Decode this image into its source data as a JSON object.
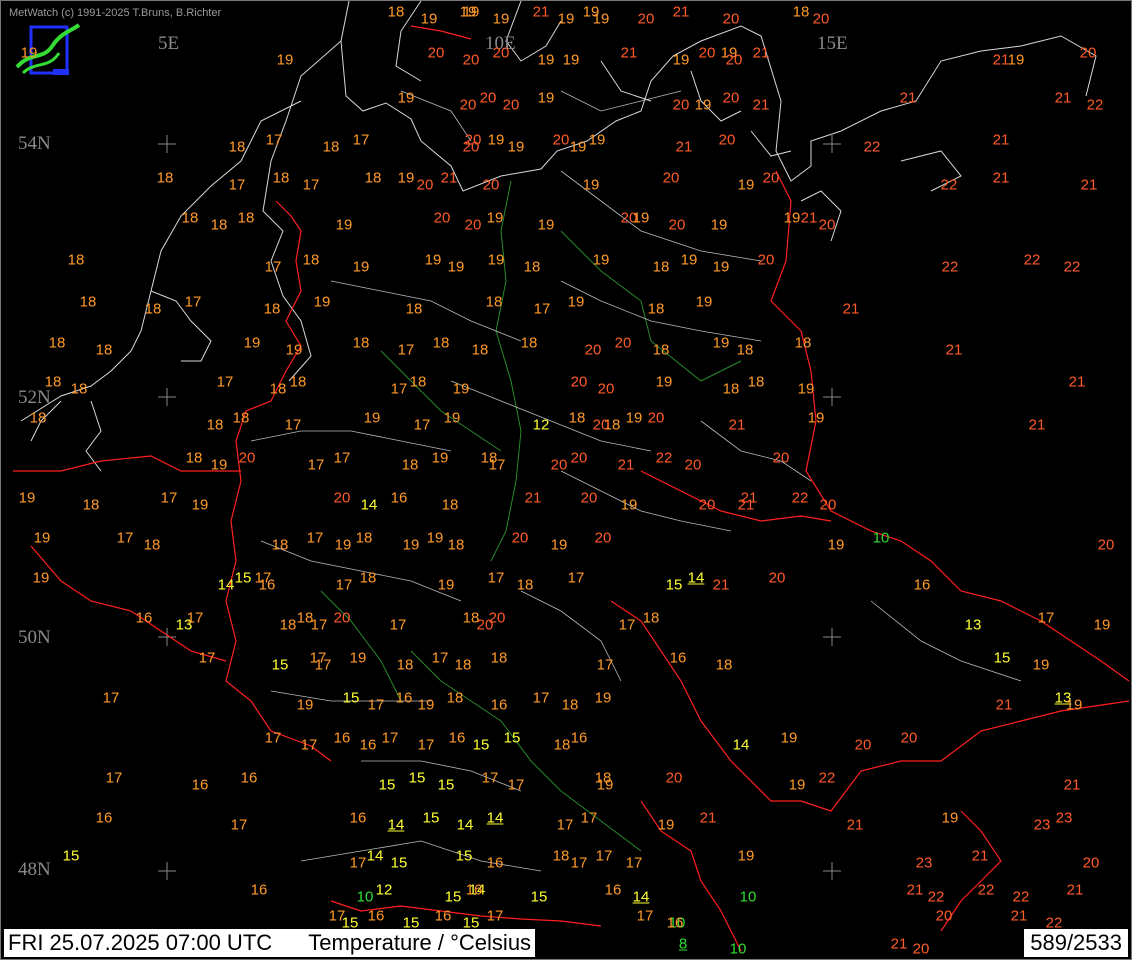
{
  "copyright": "MetWatch  (c) 1991-2025 T.Bruns, B.Richter",
  "footer": {
    "datetime": "FRI 25.07.2025 07:00 UTC",
    "parameter": "Temperature / °Celsius",
    "station_count": "589/2533"
  },
  "grid_labels": {
    "lon": [
      "5E",
      "10E",
      "15E"
    ],
    "lat": [
      "54N",
      "52N",
      "50N",
      "48N"
    ]
  },
  "colors": {
    "orange": "#ff9a2a",
    "red": "#ff5a2a",
    "yellow": "#ffff30",
    "green": "#33dd33",
    "border": "#ff2020",
    "coast": "#d8d8d8",
    "river": "#2a8a2a"
  },
  "icons": [
    "metwatch-logo-icon"
  ],
  "observations": {
    "row_020": [
      "18",
      "19",
      "19",
      "19",
      "21",
      "19",
      "19",
      "20",
      "21",
      "20",
      "18",
      "20",
      "19",
      "19"
    ],
    "row_060": [
      "19",
      "19",
      "20",
      "20",
      "20",
      "19",
      "21",
      "19",
      "20",
      "21",
      "19",
      "19",
      "20",
      "19",
      "21",
      "20"
    ],
    "row_100": [
      "19",
      "20",
      "20",
      "20",
      "19",
      "19",
      "20",
      "21",
      "21",
      "20",
      "21",
      "22"
    ],
    "row_140": [
      "17",
      "18",
      "20",
      "20",
      "19",
      "19",
      "20",
      "19",
      "19",
      "21",
      "20",
      "22",
      "21",
      "18",
      "17"
    ],
    "row_180": [
      "18",
      "17",
      "18",
      "17",
      "18",
      "20",
      "21",
      "20",
      "19",
      "19",
      "20",
      "19",
      "20",
      "22",
      "21",
      "21"
    ],
    "row_220": [
      "18",
      "18",
      "18",
      "19",
      "20",
      "20",
      "19",
      "19",
      "20",
      "20",
      "19",
      "19",
      "21",
      "20",
      "19"
    ],
    "row_260": [
      "18",
      "17",
      "18",
      "19",
      "19",
      "19",
      "19",
      "18",
      "19",
      "18",
      "19",
      "19",
      "20",
      "22",
      "22",
      "22"
    ],
    "row_300": [
      "18",
      "18",
      "17",
      "18",
      "19",
      "18",
      "18",
      "17",
      "19",
      "18",
      "19",
      "21"
    ],
    "row_340": [
      "18",
      "18",
      "19",
      "19",
      "18",
      "17",
      "18",
      "18",
      "18",
      "20",
      "20",
      "18",
      "19",
      "18",
      "18",
      "21"
    ],
    "row_380": [
      "18",
      "18",
      "17",
      "18",
      "18",
      "17",
      "18",
      "19",
      "20",
      "20",
      "19",
      "18",
      "18",
      "19",
      "21"
    ],
    "row_420": [
      "18",
      "18",
      "18",
      "17",
      "19",
      "17",
      "19",
      "12",
      "18",
      "18",
      "19",
      "20",
      "20",
      "21",
      "19",
      "21"
    ],
    "row_460": [
      "18",
      "19",
      "20",
      "17",
      "17",
      "18",
      "19",
      "17",
      "18",
      "20",
      "20",
      "21",
      "22",
      "20",
      "20"
    ],
    "row_500": [
      "19",
      "18",
      "17",
      "19",
      "20",
      "14",
      "16",
      "18",
      "21",
      "19",
      "20",
      "21",
      "22",
      "20",
      "21",
      "20"
    ],
    "row_540": [
      "19",
      "18",
      "17",
      "18",
      "17",
      "19",
      "18",
      "19",
      "19",
      "18",
      "20",
      "19",
      "20",
      "19",
      "10",
      "20"
    ],
    "row_580": [
      "19",
      "14",
      "15",
      "16",
      "17",
      "17",
      "18",
      "19",
      "17",
      "18",
      "17",
      "15",
      "14",
      "21",
      "20",
      "16"
    ],
    "row_620": [
      "16",
      "13",
      "17",
      "18",
      "18",
      "17",
      "20",
      "17",
      "18",
      "20",
      "20",
      "17",
      "18",
      "13",
      "17",
      "19"
    ],
    "row_660": [
      "17",
      "15",
      "17",
      "17",
      "19",
      "18",
      "17",
      "18",
      "18",
      "17",
      "16",
      "18",
      "15",
      "19"
    ],
    "row_700": [
      "17",
      "19",
      "15",
      "17",
      "16",
      "19",
      "18",
      "16",
      "17",
      "18",
      "19",
      "21",
      "13",
      "19"
    ],
    "row_740": [
      "17",
      "17",
      "16",
      "16",
      "17",
      "17",
      "16",
      "15",
      "15",
      "18",
      "16",
      "14",
      "19",
      "20",
      "20"
    ],
    "row_780": [
      "17",
      "16",
      "16",
      "15",
      "15",
      "15",
      "17",
      "17",
      "18",
      "19",
      "20",
      "19",
      "22",
      "21"
    ],
    "row_820": [
      "16",
      "17",
      "16",
      "14",
      "15",
      "14",
      "14",
      "17",
      "17",
      "19",
      "21",
      "21",
      "19",
      "23",
      "23"
    ],
    "row_860": [
      "15",
      "17",
      "14",
      "15",
      "15",
      "16",
      "18",
      "17",
      "17",
      "17",
      "19",
      "23",
      "21",
      "20"
    ],
    "row_900": [
      "16",
      "10",
      "12",
      "15",
      "14",
      "15",
      "16",
      "10",
      "16",
      "14",
      "21",
      "22",
      "22",
      "22",
      "21"
    ],
    "row_930": [
      "17",
      "15",
      "16",
      "15",
      "16",
      "15",
      "17",
      "10",
      "17",
      "16",
      "21",
      "22",
      "20"
    ],
    "row_950": [
      "8",
      "10",
      "21",
      "20"
    ]
  }
}
